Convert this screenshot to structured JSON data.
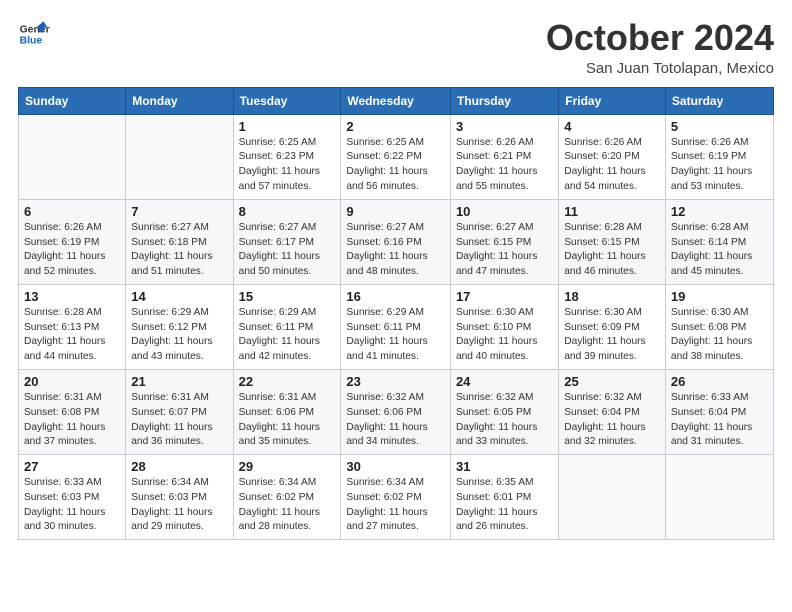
{
  "logo": {
    "line1": "General",
    "line2": "Blue"
  },
  "title": "October 2024",
  "subtitle": "San Juan Totolapan, Mexico",
  "days_of_week": [
    "Sunday",
    "Monday",
    "Tuesday",
    "Wednesday",
    "Thursday",
    "Friday",
    "Saturday"
  ],
  "weeks": [
    [
      {
        "num": "",
        "info": ""
      },
      {
        "num": "",
        "info": ""
      },
      {
        "num": "1",
        "info": "Sunrise: 6:25 AM\nSunset: 6:23 PM\nDaylight: 11 hours and 57 minutes."
      },
      {
        "num": "2",
        "info": "Sunrise: 6:25 AM\nSunset: 6:22 PM\nDaylight: 11 hours and 56 minutes."
      },
      {
        "num": "3",
        "info": "Sunrise: 6:26 AM\nSunset: 6:21 PM\nDaylight: 11 hours and 55 minutes."
      },
      {
        "num": "4",
        "info": "Sunrise: 6:26 AM\nSunset: 6:20 PM\nDaylight: 11 hours and 54 minutes."
      },
      {
        "num": "5",
        "info": "Sunrise: 6:26 AM\nSunset: 6:19 PM\nDaylight: 11 hours and 53 minutes."
      }
    ],
    [
      {
        "num": "6",
        "info": "Sunrise: 6:26 AM\nSunset: 6:19 PM\nDaylight: 11 hours and 52 minutes."
      },
      {
        "num": "7",
        "info": "Sunrise: 6:27 AM\nSunset: 6:18 PM\nDaylight: 11 hours and 51 minutes."
      },
      {
        "num": "8",
        "info": "Sunrise: 6:27 AM\nSunset: 6:17 PM\nDaylight: 11 hours and 50 minutes."
      },
      {
        "num": "9",
        "info": "Sunrise: 6:27 AM\nSunset: 6:16 PM\nDaylight: 11 hours and 48 minutes."
      },
      {
        "num": "10",
        "info": "Sunrise: 6:27 AM\nSunset: 6:15 PM\nDaylight: 11 hours and 47 minutes."
      },
      {
        "num": "11",
        "info": "Sunrise: 6:28 AM\nSunset: 6:15 PM\nDaylight: 11 hours and 46 minutes."
      },
      {
        "num": "12",
        "info": "Sunrise: 6:28 AM\nSunset: 6:14 PM\nDaylight: 11 hours and 45 minutes."
      }
    ],
    [
      {
        "num": "13",
        "info": "Sunrise: 6:28 AM\nSunset: 6:13 PM\nDaylight: 11 hours and 44 minutes."
      },
      {
        "num": "14",
        "info": "Sunrise: 6:29 AM\nSunset: 6:12 PM\nDaylight: 11 hours and 43 minutes."
      },
      {
        "num": "15",
        "info": "Sunrise: 6:29 AM\nSunset: 6:11 PM\nDaylight: 11 hours and 42 minutes."
      },
      {
        "num": "16",
        "info": "Sunrise: 6:29 AM\nSunset: 6:11 PM\nDaylight: 11 hours and 41 minutes."
      },
      {
        "num": "17",
        "info": "Sunrise: 6:30 AM\nSunset: 6:10 PM\nDaylight: 11 hours and 40 minutes."
      },
      {
        "num": "18",
        "info": "Sunrise: 6:30 AM\nSunset: 6:09 PM\nDaylight: 11 hours and 39 minutes."
      },
      {
        "num": "19",
        "info": "Sunrise: 6:30 AM\nSunset: 6:08 PM\nDaylight: 11 hours and 38 minutes."
      }
    ],
    [
      {
        "num": "20",
        "info": "Sunrise: 6:31 AM\nSunset: 6:08 PM\nDaylight: 11 hours and 37 minutes."
      },
      {
        "num": "21",
        "info": "Sunrise: 6:31 AM\nSunset: 6:07 PM\nDaylight: 11 hours and 36 minutes."
      },
      {
        "num": "22",
        "info": "Sunrise: 6:31 AM\nSunset: 6:06 PM\nDaylight: 11 hours and 35 minutes."
      },
      {
        "num": "23",
        "info": "Sunrise: 6:32 AM\nSunset: 6:06 PM\nDaylight: 11 hours and 34 minutes."
      },
      {
        "num": "24",
        "info": "Sunrise: 6:32 AM\nSunset: 6:05 PM\nDaylight: 11 hours and 33 minutes."
      },
      {
        "num": "25",
        "info": "Sunrise: 6:32 AM\nSunset: 6:04 PM\nDaylight: 11 hours and 32 minutes."
      },
      {
        "num": "26",
        "info": "Sunrise: 6:33 AM\nSunset: 6:04 PM\nDaylight: 11 hours and 31 minutes."
      }
    ],
    [
      {
        "num": "27",
        "info": "Sunrise: 6:33 AM\nSunset: 6:03 PM\nDaylight: 11 hours and 30 minutes."
      },
      {
        "num": "28",
        "info": "Sunrise: 6:34 AM\nSunset: 6:03 PM\nDaylight: 11 hours and 29 minutes."
      },
      {
        "num": "29",
        "info": "Sunrise: 6:34 AM\nSunset: 6:02 PM\nDaylight: 11 hours and 28 minutes."
      },
      {
        "num": "30",
        "info": "Sunrise: 6:34 AM\nSunset: 6:02 PM\nDaylight: 11 hours and 27 minutes."
      },
      {
        "num": "31",
        "info": "Sunrise: 6:35 AM\nSunset: 6:01 PM\nDaylight: 11 hours and 26 minutes."
      },
      {
        "num": "",
        "info": ""
      },
      {
        "num": "",
        "info": ""
      }
    ]
  ]
}
